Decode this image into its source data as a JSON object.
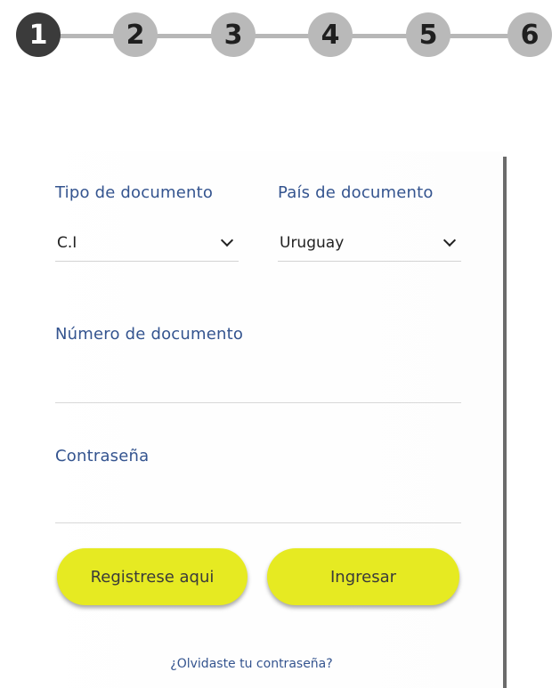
{
  "stepper": {
    "steps": [
      "1",
      "2",
      "3",
      "4",
      "5",
      "6"
    ],
    "active_step": "1"
  },
  "form": {
    "doc_type": {
      "label": "Tipo de documento",
      "value": "C.I"
    },
    "doc_country": {
      "label": "País de documento",
      "value": "Uruguay"
    },
    "doc_number": {
      "label": "Número de documento",
      "value": ""
    },
    "password": {
      "label": "Contraseña",
      "value": ""
    },
    "register_label": "Registrese aqui",
    "login_label": "Ingresar",
    "forgot_label": "¿Olvidaste tu contraseña?"
  },
  "colors": {
    "accent_button": "#e6ea22",
    "label_blue": "#34548f",
    "step_active": "#3b3b3b",
    "step_inactive": "#b9b9b9"
  }
}
